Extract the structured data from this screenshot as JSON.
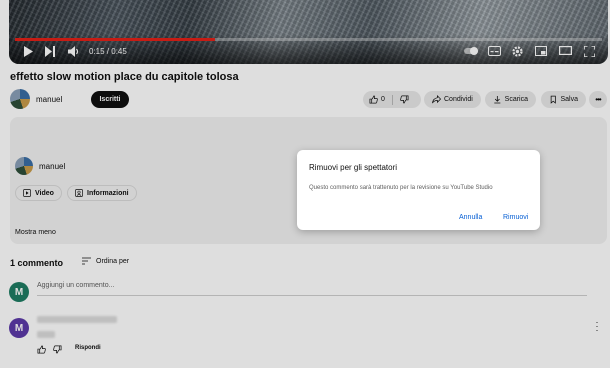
{
  "player": {
    "time": "0:15 / 0:45",
    "progress": 0.34,
    "accent": "#e52117"
  },
  "video": {
    "title": "effetto slow motion place du capitole tolosa"
  },
  "channel": {
    "name": "manuel",
    "subscribe_label": "Iscritti"
  },
  "actions": {
    "like_count": "0",
    "share_label": "Condividi",
    "download_label": "Scarica",
    "save_label": "Salva"
  },
  "description": {
    "channel_name": "manuel",
    "video_tab_label": "Video",
    "info_tab_label": "Informazioni",
    "show_less_label": "Mostra meno"
  },
  "dialog": {
    "title": "Rimuovi per gli spettatori",
    "message": "Questo commento sarà trattenuto per la revisione su YouTube Studio",
    "cancel_label": "Annulla",
    "confirm_label": "Rimuovi"
  },
  "comments": {
    "count_label": "1 commento",
    "sort_label": "Ordina per",
    "add_placeholder": "Aggiungi un commento...",
    "user_initial": "M",
    "user_color": "#1e7d63",
    "commenter_initial": "M",
    "commenter_color": "#5c3aa8",
    "reply_label": "Rispondi"
  }
}
